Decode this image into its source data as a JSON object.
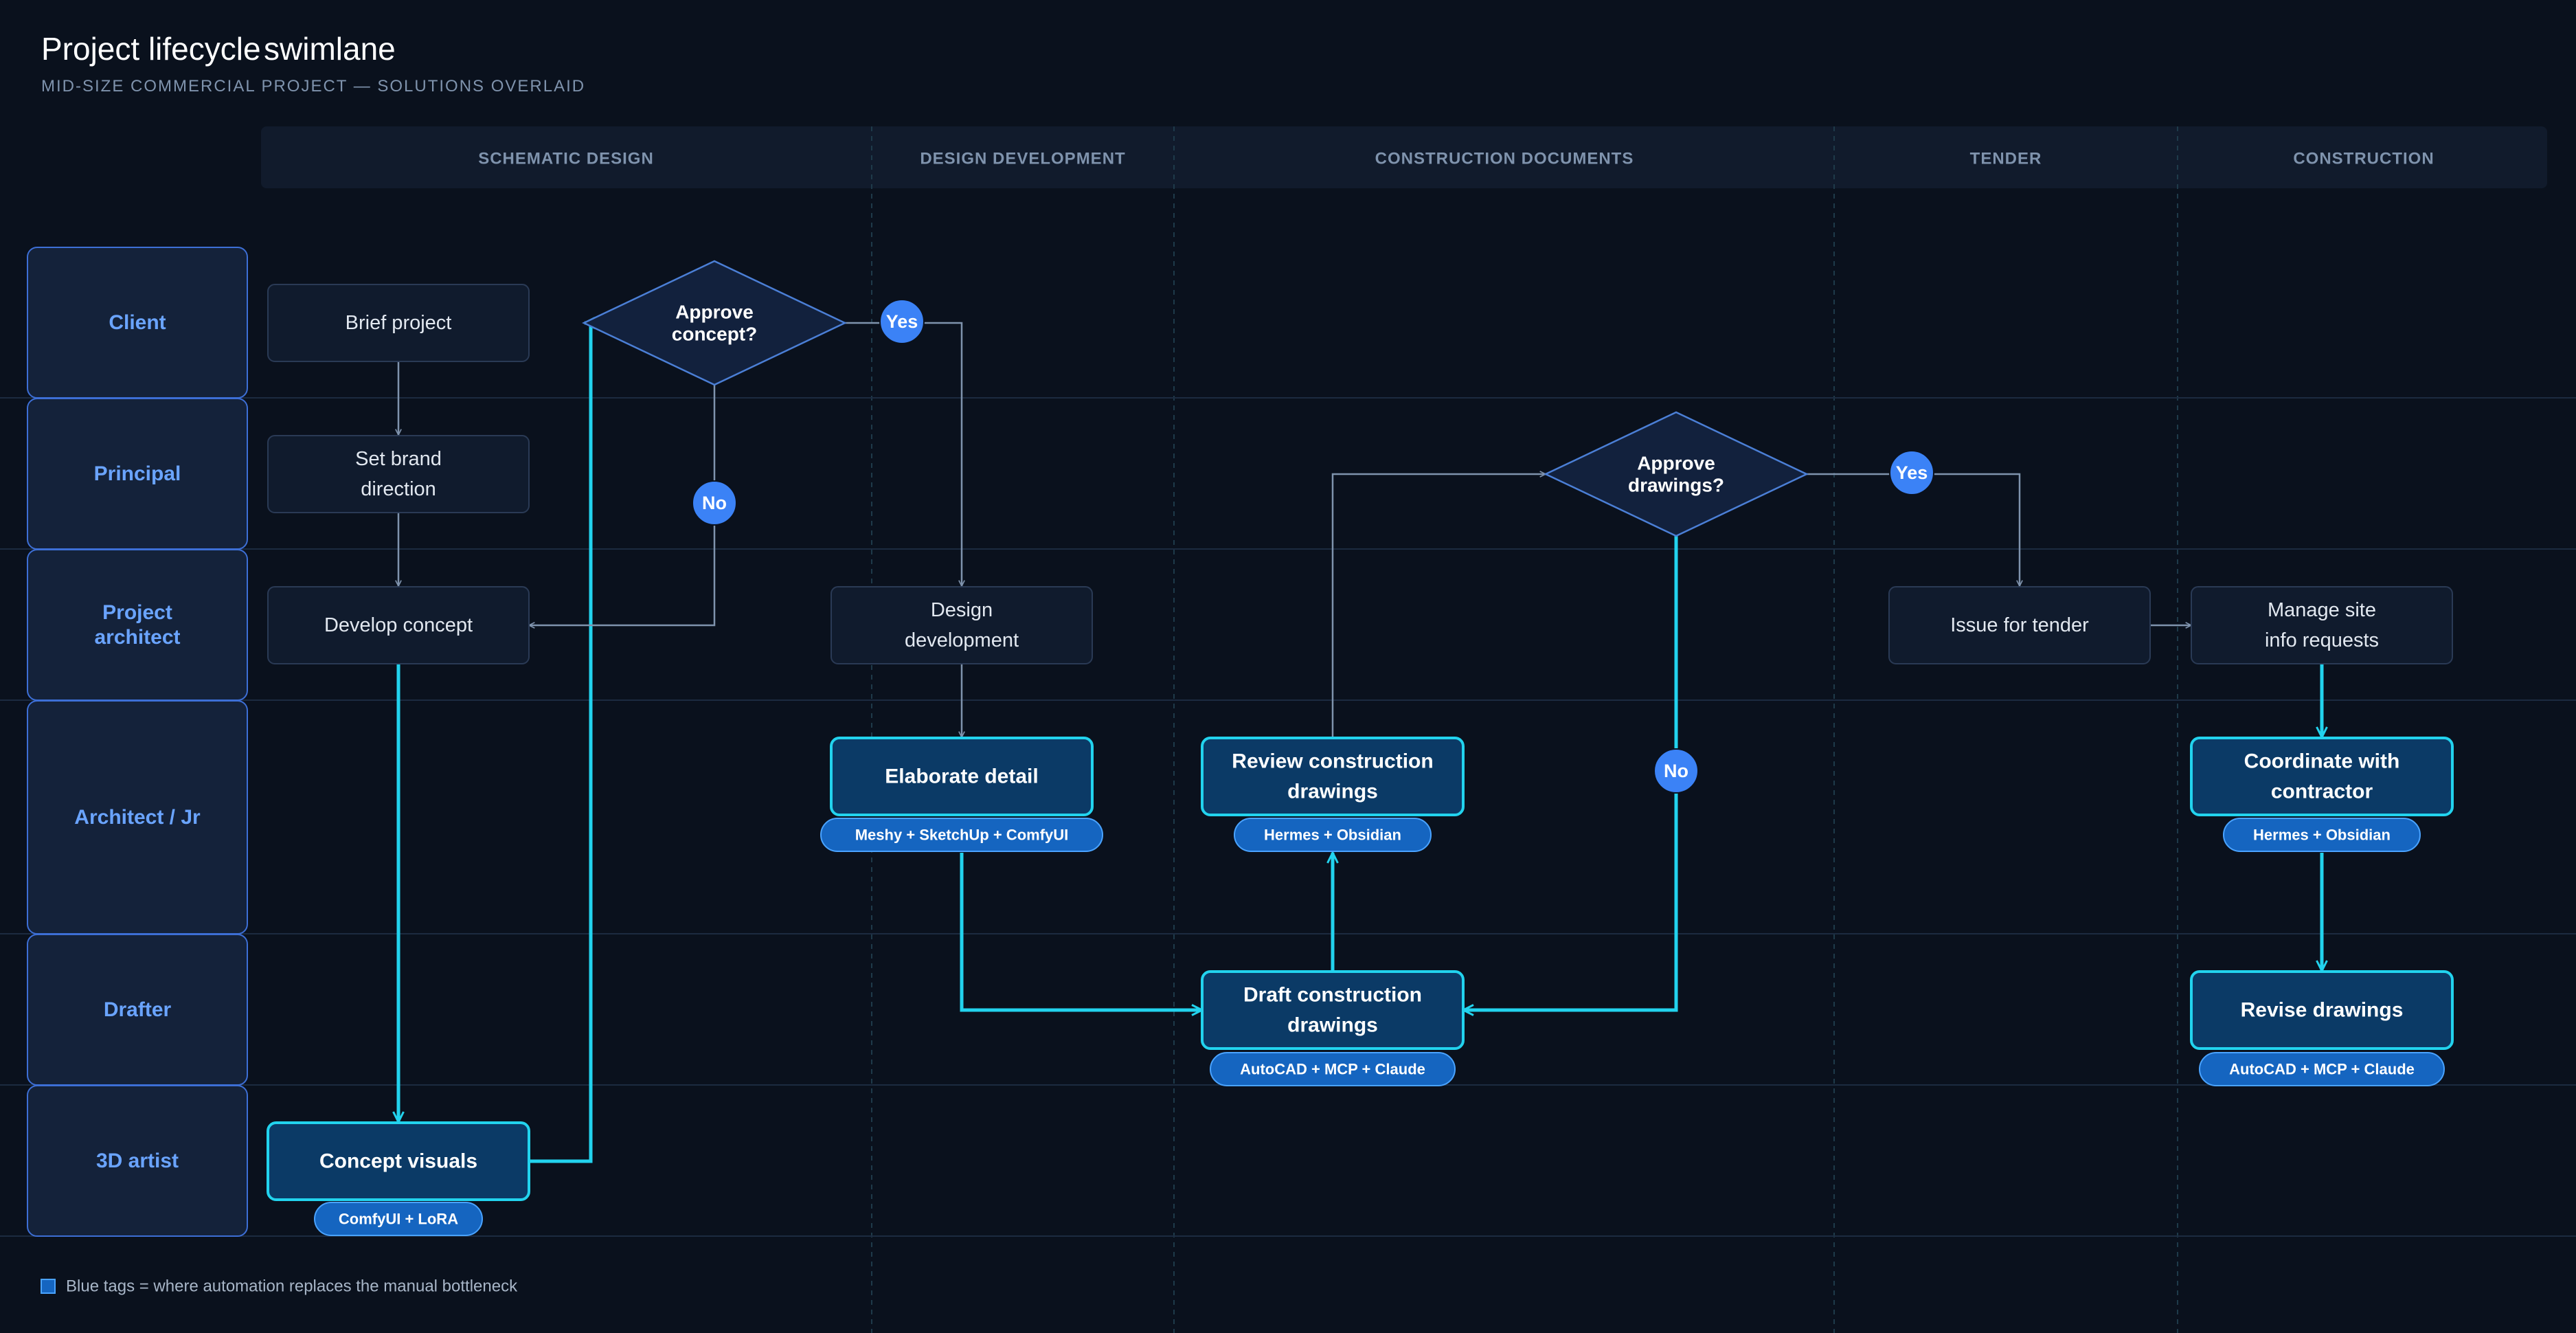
{
  "header": {
    "title_main": "Project lifecycle",
    "title_accent": "swimlane",
    "subtitle": "MID-SIZE COMMERCIAL PROJECT — SOLUTIONS OVERLAID"
  },
  "phases": [
    "SCHEMATIC DESIGN",
    "DESIGN DEVELOPMENT",
    "CONSTRUCTION DOCUMENTS",
    "TENDER",
    "CONSTRUCTION"
  ],
  "lanes": [
    "Client",
    "Principal",
    "Project\narchitect",
    "Architect / Jr",
    "Drafter",
    "3D artist"
  ],
  "nodes": {
    "brief_project": "Brief project",
    "set_brand_direction": "Set brand\ndirection",
    "develop_concept": "Develop concept",
    "concept_visuals": "Concept visuals",
    "design_development": "Design\ndevelopment",
    "elaborate_detail": "Elaborate detail",
    "review_construction_drawings": "Review construction\ndrawings",
    "draft_construction_drawings": "Draft construction\ndrawings",
    "issue_for_tender": "Issue for tender",
    "manage_site_info_requests": "Manage site\ninfo requests",
    "coordinate_with_contractor": "Coordinate with\ncontractor",
    "revise_drawings": "Revise drawings"
  },
  "decisions": {
    "approve_concept": "Approve\nconcept?",
    "approve_drawings": "Approve\ndrawings?"
  },
  "branch_labels": {
    "yes": "Yes",
    "no": "No"
  },
  "tags": {
    "concept_visuals": "ComfyUI + LoRA",
    "elaborate_detail": "Meshy + SketchUp + ComfyUI",
    "review_construction_drawings": "Hermes + Obsidian",
    "draft_construction_drawings": "AutoCAD + MCP + Claude",
    "coordinate_with_contractor": "Hermes + Obsidian",
    "revise_drawings": "AutoCAD + MCP + Claude"
  },
  "legend": {
    "text": "Blue tags = where automation replaces the manual bottleneck"
  },
  "colors": {
    "background": "#0a111d",
    "accent_blue": "#5b9bf8",
    "highlight_cyan": "#22d3ee",
    "tag_blue": "#1565c0",
    "badge_blue": "#3b82f6"
  }
}
